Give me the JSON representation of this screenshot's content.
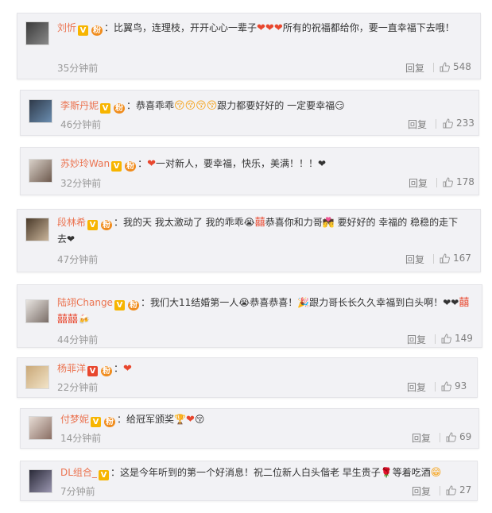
{
  "comments": [
    {
      "username": "刘忻",
      "text_before": "：比翼鸟，连理枝，开开心心一辈子",
      "emoji_mid": "❤❤❤",
      "text_after": "所有的祝福都给你，要一直幸福下去哦！",
      "time": "35分钟前",
      "reply": "回复",
      "likes": "548",
      "badge": "V",
      "fans_badge": "粉"
    },
    {
      "username": "李斯丹妮",
      "text_before": "：恭喜乖乖",
      "emoji_mid": "😚😚😚😚",
      "text_after": "跟力都要好好的 一定要幸福😏",
      "time": "46分钟前",
      "reply": "回复",
      "likes": "233",
      "badge": "V",
      "fans_badge": "粉"
    },
    {
      "username": "苏妙玲Wan",
      "text_before": "：",
      "emoji_mid": "❤",
      "text_after": "一对新人，要幸福，快乐，美满！！！❤",
      "time": "32分钟前",
      "reply": "回复",
      "likes": "178",
      "badge": "V",
      "fans_badge": "粉"
    },
    {
      "username": "段林希",
      "text_before": "：我的天 我太激动了 我的乖乖😭",
      "emoji_mid": "囍",
      "text_after": "恭喜你和力哥💏 要好好的 幸福的 稳稳的走下去❤",
      "time": "47分钟前",
      "reply": "回复",
      "likes": "167",
      "badge": "V",
      "fans_badge": "粉"
    },
    {
      "username": "陆翊Change",
      "text_before": "：我们大11结婚第一人😭恭喜恭喜！🎉跟力哥长长久久幸福到白头啊！❤❤",
      "emoji_mid": "囍囍囍",
      "text_after": "🍻",
      "time": "44分钟前",
      "reply": "回复",
      "likes": "149",
      "badge": "V",
      "fans_badge": "粉"
    },
    {
      "username": "杨菲洋",
      "text_before": "：",
      "emoji_mid": "❤",
      "text_after": "",
      "time": "22分钟前",
      "reply": "回复",
      "likes": "93",
      "badge": "V",
      "fans_badge": "粉"
    },
    {
      "username": "付梦妮",
      "text_before": "：给冠军颁奖🏆",
      "emoji_mid": "❤",
      "text_after": "😚",
      "time": "14分钟前",
      "reply": "回复",
      "likes": "69",
      "badge": "V",
      "fans_badge": "粉"
    },
    {
      "username": "DL组合_",
      "text_before": "：这是今年听到的第一个好消息！祝二位新人白头偕老 早生贵子🌹等着吃酒",
      "emoji_mid": "😁",
      "text_after": "",
      "time": "7分钟前",
      "reply": "回复",
      "likes": "27",
      "badge": "V",
      "fans_badge": ""
    }
  ],
  "colors": {
    "username": "#eb7350",
    "card_bg": "#f2f2f5",
    "muted": "#808080",
    "heart": "#e8472e"
  },
  "icons": {
    "like": "thumbs-up-icon",
    "badge": "verified-v-icon"
  }
}
